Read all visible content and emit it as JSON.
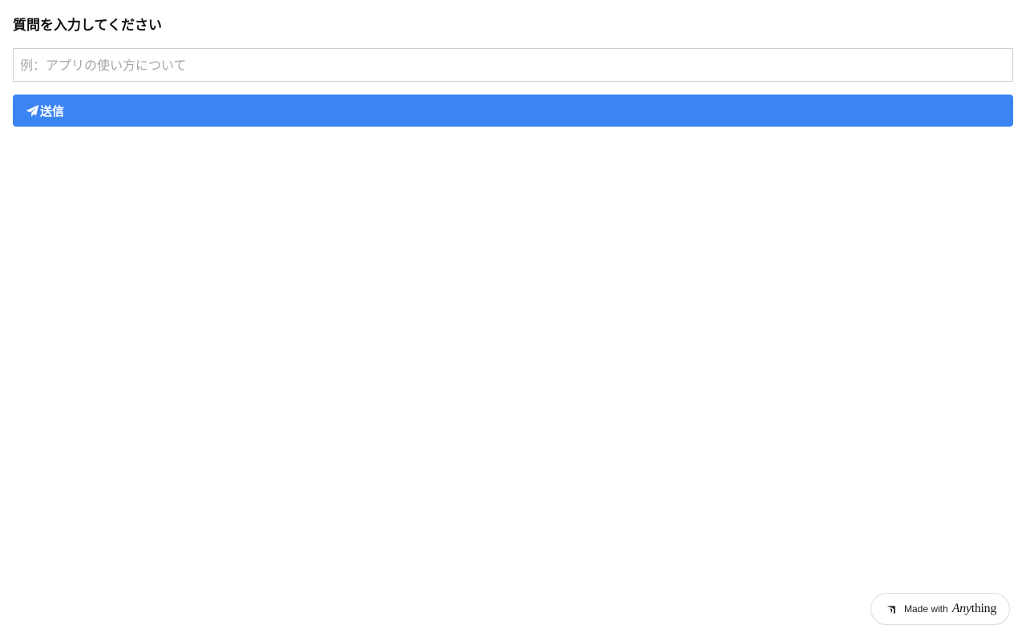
{
  "form": {
    "label": "質問を入力してください",
    "input_value": "",
    "input_placeholder": "例：アプリの使い方について",
    "submit_label": "送信",
    "submit_icon": "paper-plane-icon",
    "accent_color": "#3b84f4"
  },
  "badge": {
    "made_with": "Made with",
    "brand_any": "Any",
    "brand_thing": "thing",
    "icon": "anything-logo-icon"
  }
}
